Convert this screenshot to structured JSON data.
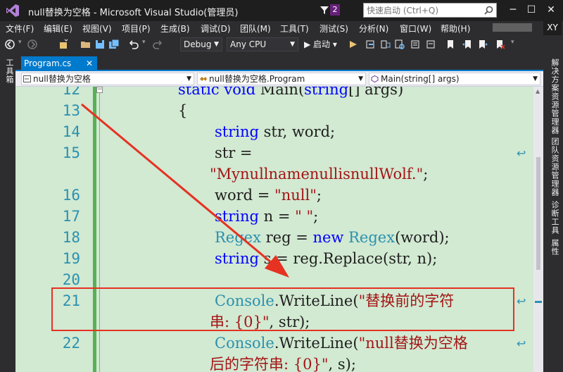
{
  "window": {
    "title": "null替换为空格 - Microsoft Visual Studio(管理员)",
    "notification_count": "2",
    "quick_launch_placeholder": "快速启动 (Ctrl+Q)",
    "minimize": "─",
    "maximize": "☐",
    "close": "✕"
  },
  "menu": [
    "文件(F)",
    "编辑(E)",
    "视图(V)",
    "项目(P)",
    "生成(B)",
    "调试(D)",
    "团队(M)",
    "工具(T)",
    "测试(S)",
    "分析(N)",
    "窗口(W)",
    "帮助(H)"
  ],
  "user_initials": "XY",
  "toolbar": {
    "configuration": "Debug",
    "platform": "Any CPU",
    "start_label": "▶ 启动 ▾"
  },
  "left_strip": {
    "toolbox": "工具箱"
  },
  "right_strip": {
    "solution_explorer": "解决方案资源管理器",
    "team_explorer": "团队资源管理器",
    "diagnostic_tools": "诊断工具",
    "properties": "属性"
  },
  "document_tab": {
    "label": "Program.cs",
    "close": "✕"
  },
  "navigation": {
    "project": "null替换为空格",
    "type": "null替换为空格.Program",
    "member": "Main(string[] args)"
  },
  "editor": {
    "line_numbers": [
      "12",
      "13",
      "14",
      "15",
      "16",
      "17",
      "18",
      "19",
      "20",
      "21",
      "22"
    ],
    "lines": {
      "l12": {
        "kw1": "static",
        "sp1": " ",
        "kw2": "void",
        "rest": " Main(",
        "kw3": "string",
        "tail": "[] args)"
      },
      "l13": "{",
      "l14": {
        "kw": "string",
        "rest": " str, word;"
      },
      "l15a": "str =",
      "l15b": "\"MynullnamenullisnullWolf.\"",
      "l15c": ";",
      "l16": {
        "pre": "word = ",
        "str": "\"null\"",
        "post": ";"
      },
      "l17": {
        "kw": "string",
        "pre": " n = ",
        "str": "\" \"",
        "post": ";"
      },
      "l18": {
        "ty1": "Regex",
        "pre": " reg = ",
        "kw": "new",
        "sp": " ",
        "ty2": "Regex",
        "post": "(word);"
      },
      "l19": {
        "kw": "string",
        "post": " s = reg.Replace(str, n);"
      },
      "l21a": {
        "ty": "Console",
        "pre": ".WriteLine(",
        "str": "\"替换前的字符"
      },
      "l21b": {
        "str": "串: {0}\"",
        "post": ", str);"
      },
      "l22a": {
        "ty": "Console",
        "pre": ".WriteLine(",
        "str": "\"null替换为空格"
      },
      "l22b": {
        "str": "后的字符串: {0}\"",
        "post": ", s);"
      }
    }
  },
  "colors": {
    "editor_background": "#d2e9d2",
    "keyword": "#0000ff",
    "type": "#2b91af",
    "string": "#a31515",
    "annotation": "#e53222",
    "accent": "#007acc"
  }
}
